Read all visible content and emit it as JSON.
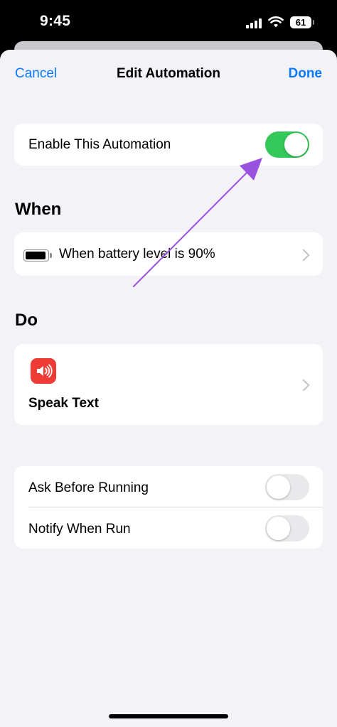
{
  "status_bar": {
    "time": "9:45",
    "battery_level": "61"
  },
  "nav": {
    "cancel": "Cancel",
    "title": "Edit Automation",
    "done": "Done"
  },
  "enable_row": {
    "label": "Enable This Automation",
    "enabled": true
  },
  "when_section": {
    "title": "When",
    "trigger": "When battery level is 90%",
    "icon": "battery-icon"
  },
  "do_section": {
    "title": "Do",
    "action": "Speak Text",
    "icon": "speaker-icon",
    "icon_color": "#ef3b36"
  },
  "options": [
    {
      "label": "Ask Before Running",
      "enabled": false
    },
    {
      "label": "Notify When Run",
      "enabled": false
    }
  ],
  "colors": {
    "accent": "#0a7bff",
    "toggle_on": "#34c759",
    "annotation_arrow": "#9b51e0"
  }
}
